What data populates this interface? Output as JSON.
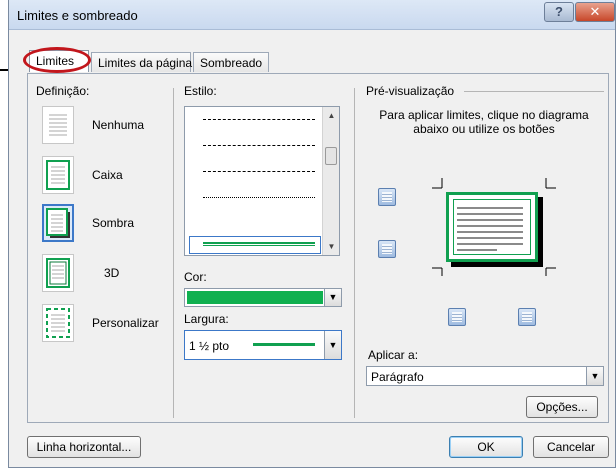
{
  "window": {
    "title": "Limites e sombreado"
  },
  "titlebar": {
    "help_label": "?",
    "close_label": "✕"
  },
  "tabs": [
    {
      "label": "Limites",
      "active": true
    },
    {
      "label": "Limites da página",
      "active": false
    },
    {
      "label": "Sombreado",
      "active": false
    }
  ],
  "definicao": {
    "heading": "Definição:",
    "items": [
      {
        "label": "Nenhuma",
        "icon": "none-icon"
      },
      {
        "label": "Caixa",
        "icon": "box-icon"
      },
      {
        "label": "Sombra",
        "icon": "shadow-icon",
        "selected": true
      },
      {
        "label": "3D",
        "icon": "3d-icon"
      },
      {
        "label": "Personalizar",
        "icon": "custom-icon"
      }
    ]
  },
  "estilo": {
    "heading": "Estilo:"
  },
  "cor": {
    "heading": "Cor:",
    "value_color": "#10b050"
  },
  "largura": {
    "heading": "Largura:",
    "value": "1 ½ pto"
  },
  "preview": {
    "heading": "Pré-visualização",
    "instructions": "Para aplicar limites, clique no diagrama abaixo ou utilize os botões"
  },
  "aplicar": {
    "heading": "Aplicar a:",
    "value": "Parágrafo"
  },
  "buttons": {
    "options": "Opções...",
    "horizontal_line": "Linha horizontal...",
    "ok": "OK",
    "cancel": "Cancelar"
  },
  "colors": {
    "accent_green": "#10a050",
    "highlight_red": "#c2161c",
    "selection_blue": "#3c78c8"
  }
}
